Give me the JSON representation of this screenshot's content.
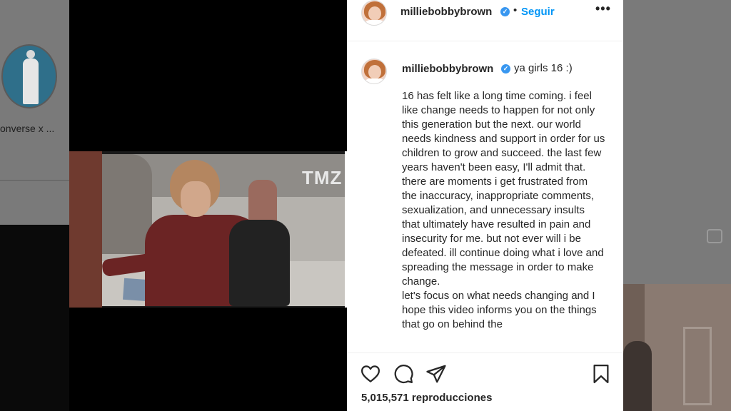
{
  "background": {
    "left_profile_label": "onverse x ..."
  },
  "video": {
    "sign_text": "TMZ"
  },
  "post": {
    "header": {
      "username": "milliebobbybrown",
      "verified_mark": "✓",
      "follow_label": "Seguir",
      "more_label": "•••"
    },
    "caption": {
      "username": "milliebobbybrown",
      "verified_mark": "✓",
      "short_text": "ya girls 16 :)",
      "paragraph_1": "16 has felt like a long time coming. i feel like change needs to happen for not only this generation but the next. our world needs kindness and support in order for us children to grow and succeed. the last few years haven't been easy, I'll admit that. there are moments i get frustrated from the inaccuracy, inappropriate comments, sexualization, and unnecessary insults that ultimately have resulted in pain and insecurity for me. but not ever will i be defeated. ill continue doing what i love and spreading the message in order to make change.",
      "paragraph_2": "let's focus on what needs changing and I hope this video informs you on the things that go on behind the"
    },
    "actions": {
      "icons": [
        "heart-icon",
        "comment-icon",
        "share-icon",
        "bookmark-icon"
      ],
      "views_text": "5,015,571 reproducciones"
    }
  },
  "colors": {
    "link_blue": "#0095f6",
    "verified_blue": "#3897f0",
    "text": "#262626"
  }
}
